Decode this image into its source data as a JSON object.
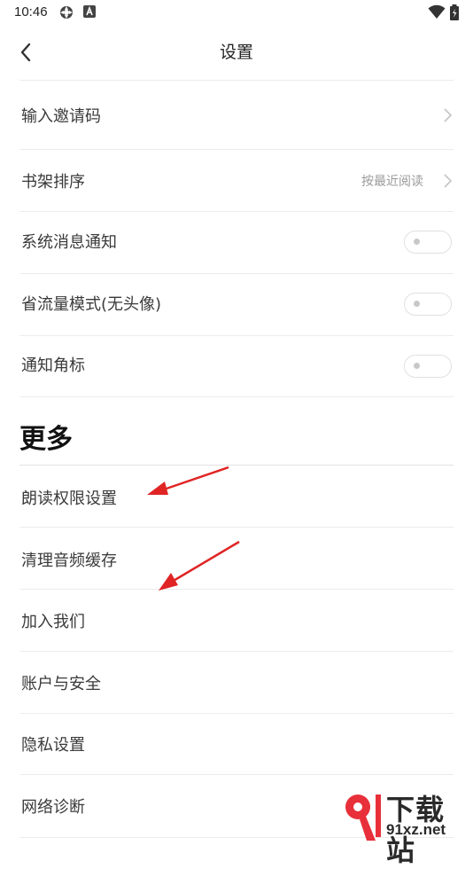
{
  "status_bar": {
    "time": "10:46"
  },
  "header": {
    "title": "设置"
  },
  "settings": {
    "invite": {
      "label": "输入邀请码"
    },
    "shelf_sort": {
      "label": "书架排序",
      "value": "按最近阅读"
    },
    "system_notify": {
      "label": "系统消息通知",
      "enabled": false
    },
    "data_saver": {
      "label": "省流量模式(无头像)",
      "enabled": false
    },
    "badge": {
      "label": "通知角标",
      "enabled": false
    }
  },
  "more": {
    "title": "更多",
    "items": [
      {
        "label": "朗读权限设置"
      },
      {
        "label": "清理音频缓存"
      },
      {
        "label": "加入我们"
      },
      {
        "label": "账户与安全"
      },
      {
        "label": "隐私设置"
      },
      {
        "label": "网络诊断"
      }
    ]
  },
  "watermark": {
    "brand": "下载站",
    "url": "91xz.net"
  },
  "colors": {
    "annotation_arrow": "#e02424",
    "divider": "#ececec",
    "toggle_border": "#e1e1e1"
  }
}
